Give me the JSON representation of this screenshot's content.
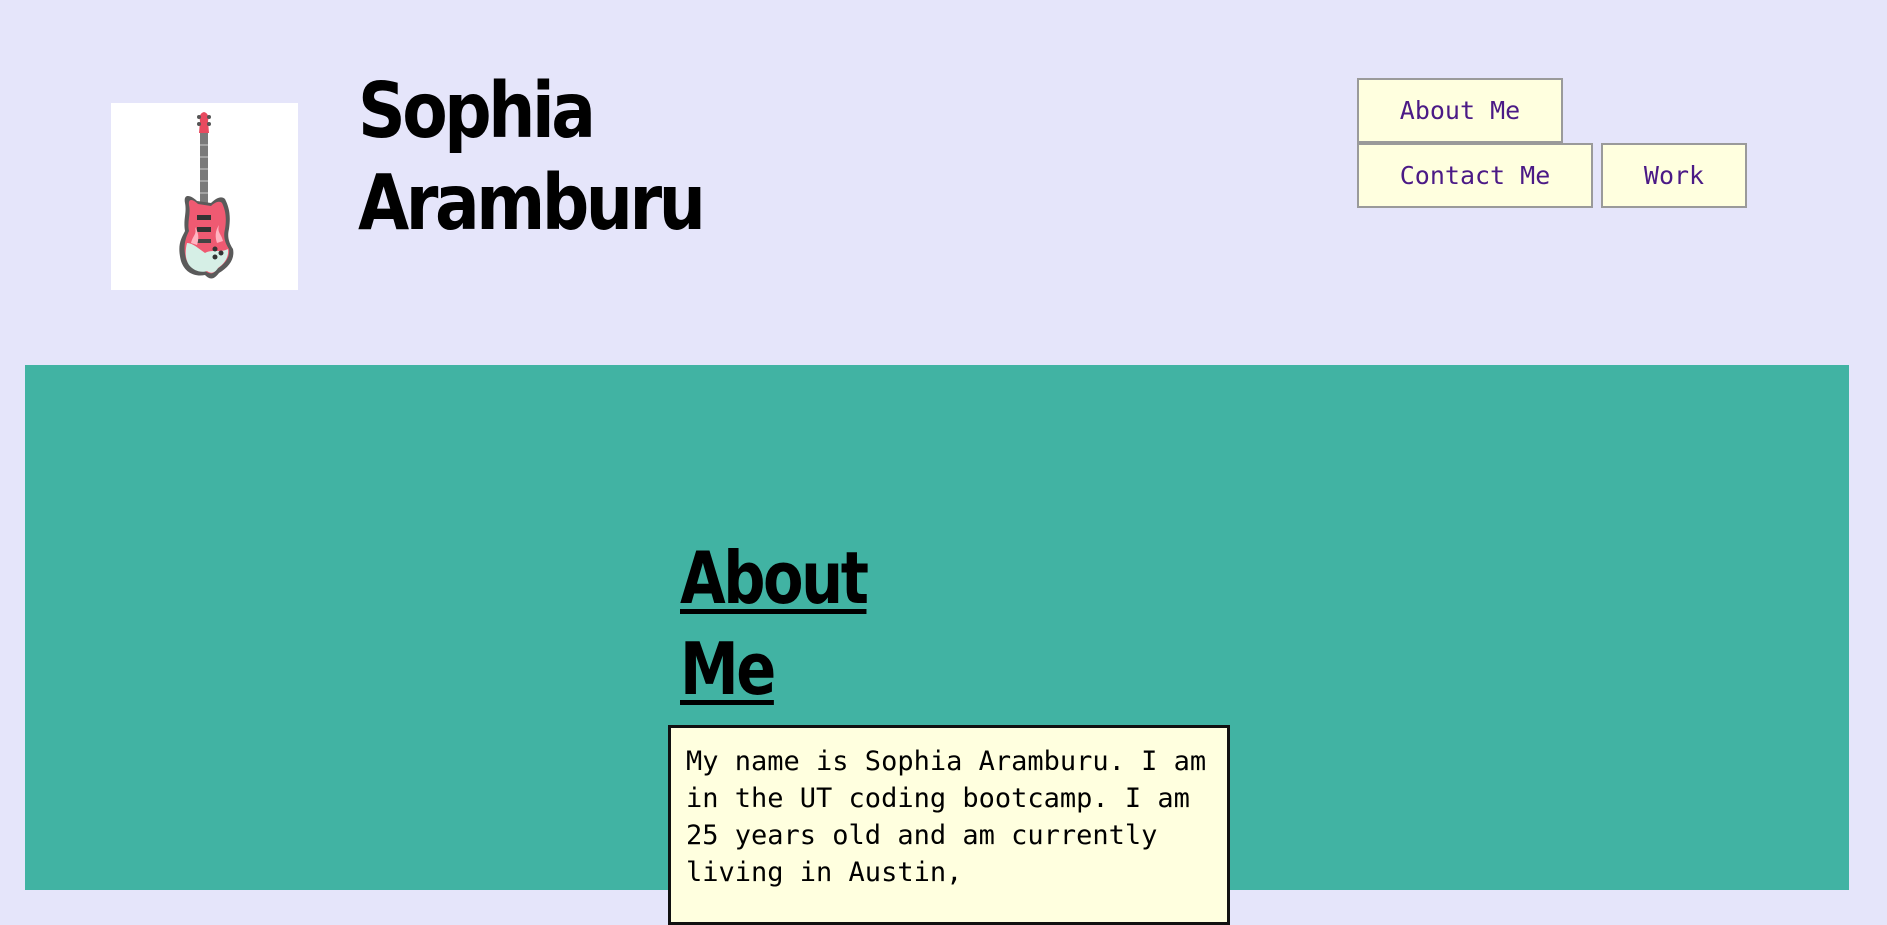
{
  "header": {
    "logo_icon": "electric-guitar-icon",
    "title": "Sophia Aramburu"
  },
  "nav": {
    "about": "About Me",
    "contact": "Contact Me",
    "work": "Work"
  },
  "about": {
    "heading": "About Me",
    "text": "My name is Sophia Aramburu. I am in the UT coding bootcamp. I am 25 years old and am currently living in Austin,"
  },
  "colors": {
    "page_background": "#e5e5fa",
    "section_background": "#41b3a3",
    "button_background": "#ffffdf",
    "button_text": "#4b1a86"
  }
}
